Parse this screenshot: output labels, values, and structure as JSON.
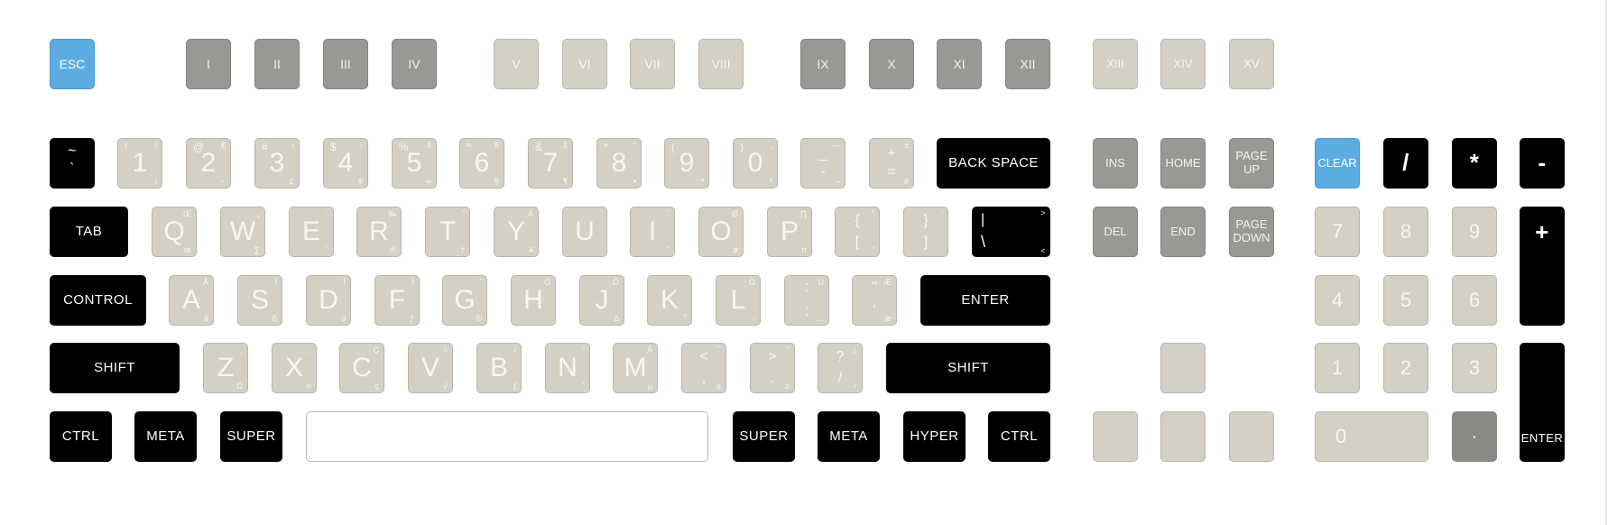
{
  "function_row": {
    "esc": "ESC",
    "group1": [
      "I",
      "II",
      "III",
      "IV"
    ],
    "group2": [
      "V",
      "VI",
      "VII",
      "VIII"
    ],
    "group3": [
      "IX",
      "X",
      "XI",
      "XII"
    ],
    "group4": [
      "XIII",
      "XIV",
      "XV"
    ]
  },
  "number_row": {
    "tilde": {
      "top": "~",
      "bottom": "`"
    },
    "keys": [
      {
        "main": "1",
        "shift": "!",
        "alt": "/",
        "alt2": "i"
      },
      {
        "main": "2",
        "shift": "@",
        "alt": "€",
        "alt2": "~"
      },
      {
        "main": "3",
        "shift": "#",
        "alt": "‹",
        "alt2": "£"
      },
      {
        "main": "4",
        "shift": "$",
        "alt": "›",
        "alt2": "¢"
      },
      {
        "main": "5",
        "shift": "%",
        "alt": "fi",
        "alt2": "∞"
      },
      {
        "main": "6",
        "shift": "^",
        "alt": "fl",
        "alt2": "§"
      },
      {
        "main": "7",
        "shift": "&",
        "alt": "‡",
        "alt2": "¶"
      },
      {
        "main": "8",
        "shift": "*",
        "alt": "°",
        "alt2": "•"
      },
      {
        "main": "9",
        "shift": "(",
        "alt": "·",
        "alt2": "ª"
      },
      {
        "main": "0",
        "shift": ")",
        "alt": "‚",
        "alt2": "º"
      }
    ],
    "minus": {
      "top": "_",
      "bottom": "-",
      "alt": "—",
      "alt2": "–"
    },
    "equals": {
      "top": "+",
      "bottom": "=",
      "alt": "±",
      "alt2": "≠"
    },
    "backspace": "BACK SPACE"
  },
  "qwerty_row": {
    "tab": "TAB",
    "letters": [
      {
        "main": "Q",
        "alt": "Œ",
        "alt2": "œ"
      },
      {
        "main": "W",
        "alt": "„",
        "alt2": "∑"
      },
      {
        "main": "E",
        "alt": "´",
        "alt2": "´"
      },
      {
        "main": "R",
        "alt": "‰",
        "alt2": "®"
      },
      {
        "main": "T",
        "alt": "ˇ",
        "alt2": "†"
      },
      {
        "main": "Y",
        "alt": "Á",
        "alt2": "¥"
      },
      {
        "main": "U",
        "alt": "¨",
        "alt2": "¨"
      },
      {
        "main": "I",
        "alt": "ˆ",
        "alt2": "ˆ"
      },
      {
        "main": "O",
        "alt": "Ø",
        "alt2": "ø"
      },
      {
        "main": "P",
        "alt": "∏",
        "alt2": "π"
      }
    ],
    "lbracket": {
      "top": "{",
      "bottom": "[",
      "alt": "”",
      "alt2": "“"
    },
    "rbracket": {
      "top": "}",
      "bottom": "]",
      "alt": "’",
      "alt2": "‘"
    },
    "backslash": {
      "top": "|",
      "bottom": "\\",
      "alt": ">",
      "alt2": "<"
    }
  },
  "home_row": {
    "control": "CONTROL",
    "letters": [
      {
        "main": "A",
        "alt": "Å",
        "alt2": "å"
      },
      {
        "main": "S",
        "alt": "Í",
        "alt2": "ß"
      },
      {
        "main": "D",
        "alt": "Î",
        "alt2": "∂"
      },
      {
        "main": "F",
        "alt": "Ï",
        "alt2": "ƒ"
      },
      {
        "main": "G",
        "alt": "˝",
        "alt2": "©"
      },
      {
        "main": "H",
        "alt": "Ó",
        "alt2": "˙"
      },
      {
        "main": "J",
        "alt": "Ô",
        "alt2": "∆"
      },
      {
        "main": "K",
        "alt": "",
        "alt2": "˚"
      },
      {
        "main": "L",
        "alt": "Ò",
        "alt2": "¬"
      }
    ],
    "semicolon": {
      "top": ":",
      "bottom": ";",
      "alt": "Ú",
      "alt2": "…"
    },
    "quote": {
      "top": "\"",
      "bottom": "'",
      "alt": "Æ",
      "alt2": "æ"
    },
    "enter": "ENTER"
  },
  "bottom_row": {
    "shift_left": "SHIFT",
    "letters": [
      {
        "main": "Z",
        "alt": "¸",
        "alt2": "Ω"
      },
      {
        "main": "X",
        "alt": "˛",
        "alt2": "≈"
      },
      {
        "main": "C",
        "alt": "Ç",
        "alt2": "ç"
      },
      {
        "main": "V",
        "alt": "◊",
        "alt2": "√"
      },
      {
        "main": "B",
        "alt": "ı",
        "alt2": "∫"
      },
      {
        "main": "N",
        "alt": "˜",
        "alt2": "˜"
      },
      {
        "main": "M",
        "alt": "Â",
        "alt2": "µ"
      }
    ],
    "comma": {
      "top": "<",
      "bottom": ",",
      "alt": "¯",
      "alt2": "≤"
    },
    "period": {
      "top": ">",
      "bottom": ".",
      "alt": "˘",
      "alt2": "≥"
    },
    "slash": {
      "top": "?",
      "bottom": "/",
      "alt": "¿",
      "alt2": "÷"
    },
    "shift_right": "SHIFT"
  },
  "modifier_row": {
    "left": [
      "CTRL",
      "META",
      "SUPER"
    ],
    "right": [
      "SUPER",
      "META",
      "HYPER",
      "CTRL"
    ]
  },
  "nav_cluster": {
    "ins": "INS",
    "home": "HOME",
    "page_up": "PAGE UP",
    "del": "DEL",
    "end": "END",
    "page_down": "PAGE DOWN"
  },
  "numpad": {
    "clear": "CLEAR",
    "divide": "/",
    "multiply": "*",
    "minus": "-",
    "row1": [
      "7",
      "8",
      "9"
    ],
    "plus": "+",
    "row2": [
      "4",
      "5",
      "6"
    ],
    "row3": [
      "1",
      "2",
      "3"
    ],
    "zero": "0",
    "decimal": "·",
    "enter": "ENTER"
  },
  "colors": {
    "black": "#000000",
    "dark_gray": "#9a9894",
    "light_beige": "#d4d1c4",
    "blue": "#5cabe3"
  }
}
